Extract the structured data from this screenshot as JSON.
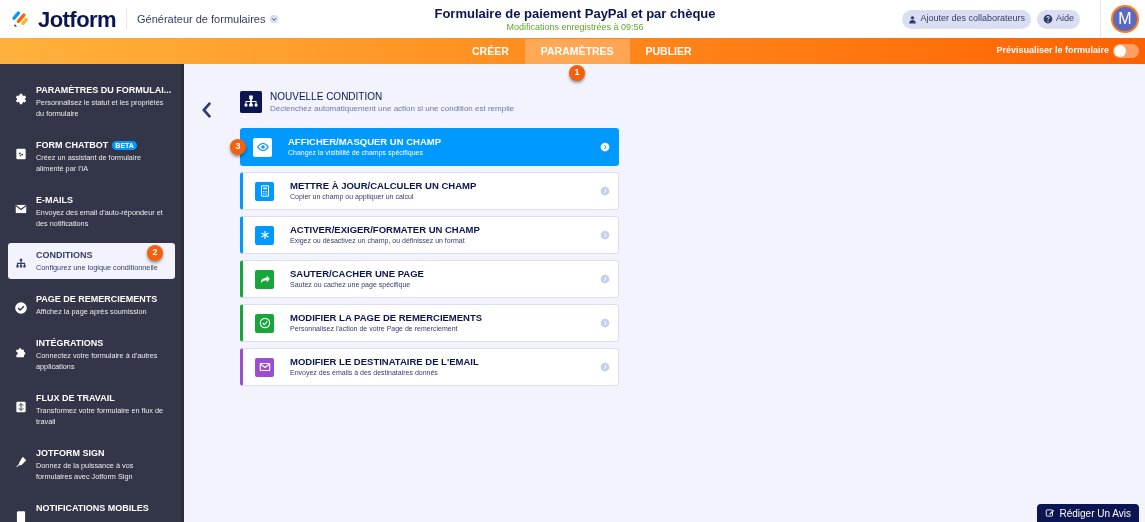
{
  "header": {
    "logo": "Jotform",
    "product": "Générateur de formulaires",
    "form_title": "Formulaire de paiement PayPal et par chèque",
    "save_status": "Modifications enregistrées à 09:56",
    "collaborators_button": "Ajouter des collaborateurs",
    "help_button": "Aide",
    "avatar": "M"
  },
  "tabs": [
    {
      "label": "CRÉER",
      "selected": false
    },
    {
      "label": "PARAMÈTRES",
      "selected": true,
      "step": "1"
    },
    {
      "label": "PUBLIER",
      "selected": false
    }
  ],
  "preview": {
    "label": "Prévisualiser le formulaire",
    "on": false
  },
  "sidebar": [
    {
      "kind": "gear",
      "title": "PARAMÈTRES DU FORMULAI...",
      "description": "Personnalisez le statut et les propriétés du formulaire",
      "selected": false
    },
    {
      "kind": "chatbot",
      "title": "FORM CHATBOT",
      "badge": "BETA",
      "description": "Créez un assistant de formulaire alimenté par l'IA",
      "selected": false
    },
    {
      "kind": "mail",
      "title": "E-MAILS",
      "description": "Envoyez des email d'auto-répondeur et des notifications",
      "selected": false
    },
    {
      "kind": "tree",
      "title": "CONDITIONS",
      "description": "Configurez une logique conditionnelle",
      "selected": true,
      "step": "2"
    },
    {
      "kind": "check",
      "title": "PAGE DE REMERCIEMENTS",
      "description": "Affichez la page après soumission",
      "selected": false
    },
    {
      "kind": "puzzle",
      "title": "INTÉGRATIONS",
      "description": "Connectez votre formulaire à d'autres applications",
      "selected": false
    },
    {
      "kind": "flow",
      "title": "FLUX DE TRAVAIL",
      "description": "Transformez votre formulaire en flux de travail",
      "selected": false
    },
    {
      "kind": "pen",
      "title": "JOTFORM SIGN",
      "description": "Donnez de la puissance à vos formulaires avec Jotform Sign",
      "selected": false
    },
    {
      "kind": "phone",
      "title": "NOTIFICATIONS MOBILES",
      "selected": false
    }
  ],
  "panel": {
    "title": "NOUVELLE CONDITION",
    "subtitle": "Déclenchez automatiquement une action si une condition est remplie"
  },
  "conditions": [
    {
      "kind": "eye",
      "color": "#0099ff",
      "title": "AFFICHER/MASQUER UN CHAMP",
      "description": "Changez la visibilité de champs spécifiques",
      "selected": true,
      "step": "3"
    },
    {
      "kind": "calculator",
      "color": "#0099ff",
      "title": "METTRE À JOUR/CALCULER UN CHAMP",
      "description": "Copier un champ ou appliquer un calcul",
      "selected": false
    },
    {
      "kind": "asterisk",
      "color": "#0099ff",
      "title": "ACTIVER/EXIGER/FORMATER UN CHAMP",
      "description": "Exigez ou désactivez un champ, ou définissez un format",
      "selected": false
    },
    {
      "kind": "arrow",
      "color": "#18a63b",
      "title": "SAUTER/CACHER UNE PAGE",
      "description": "Sautez ou cachez une page spécifique",
      "selected": false
    },
    {
      "kind": "check",
      "color": "#18a63b",
      "title": "MODIFIER LA PAGE DE REMERCIEMENTS",
      "description": "Personnalisez l'action de votre Page de remerciement",
      "selected": false
    },
    {
      "kind": "mail",
      "color": "#9c4dd3",
      "title": "MODIFIER LE DESTINATAIRE DE L'EMAIL",
      "description": "Envoyez des emails à des destinataires donnés",
      "selected": false
    }
  ],
  "review_button": "Rédiger Un Avis"
}
